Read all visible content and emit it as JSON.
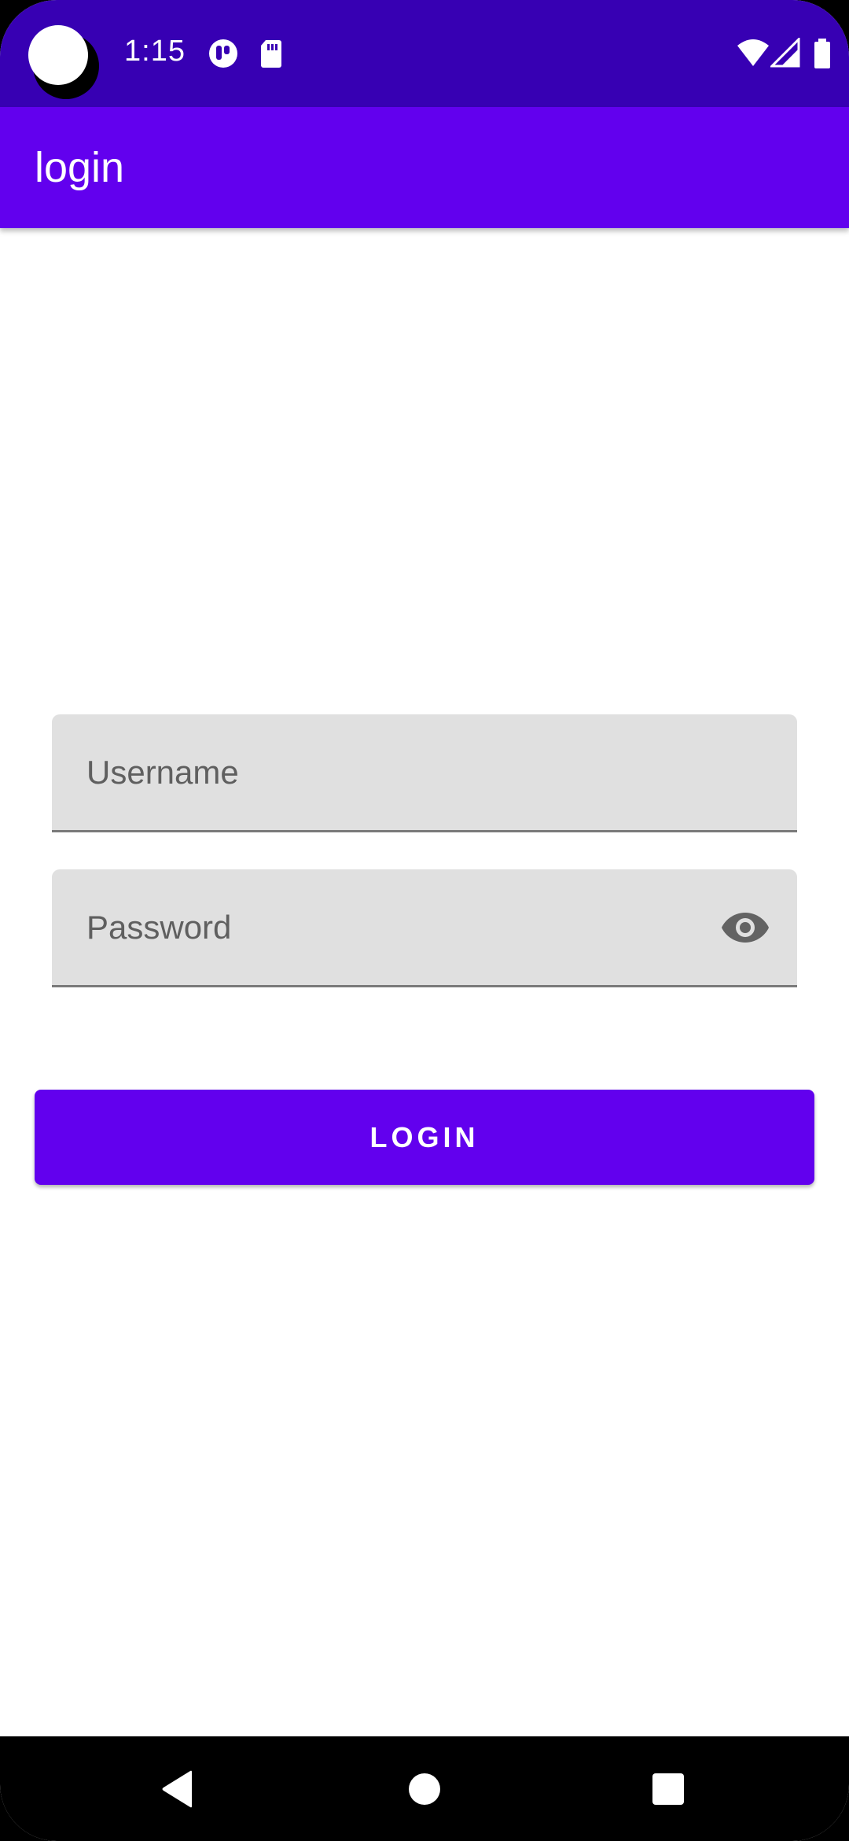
{
  "status_bar": {
    "time": "1:15",
    "icons": [
      "camera-cutout",
      "notification-app-icon",
      "sd-card-icon",
      "wifi-icon",
      "cell-signal-icon",
      "battery-icon"
    ],
    "background": "#3700b3"
  },
  "app_bar": {
    "title": "login",
    "background": "#6200ee"
  },
  "form": {
    "username": {
      "placeholder": "Username",
      "value": ""
    },
    "password": {
      "placeholder": "Password",
      "value": "",
      "toggle_icon": "eye-icon"
    },
    "login_label": "LOGIN",
    "accent_color": "#6200ee"
  },
  "nav_bar": {
    "icons": [
      "back-icon",
      "home-icon",
      "recents-icon"
    ]
  }
}
